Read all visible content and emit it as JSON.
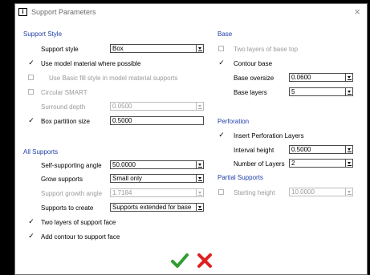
{
  "window": {
    "title": "Support Parameters",
    "close": "×"
  },
  "support_style": {
    "section": "Support Style",
    "style_label": "Support style",
    "style_value": "Box",
    "use_model_material": "Use model material where possible",
    "basic_fill": "Use Basic fill style in model material supports",
    "circular_smart": "Circular SMART",
    "surround_depth_label": "Surround depth",
    "surround_depth_value": "0.0500",
    "box_partition_label": "Box partition size",
    "box_partition_value": "0.5000"
  },
  "all_supports": {
    "section": "All Supports",
    "angle_label": "Self-supporting angle",
    "angle_value": "50.0000",
    "grow_label": "Grow supports",
    "grow_value": "Small only",
    "growth_angle_label": "Support growth angle",
    "growth_angle_value": "1.7184",
    "create_label": "Supports to create",
    "create_value": "Supports extended for base",
    "two_layers_face": "Two layers of support face",
    "add_contour": "Add contour to support face"
  },
  "base": {
    "section": "Base",
    "two_layers_top": "Two layers of base top",
    "contour_base": "Contour base",
    "oversize_label": "Base oversize",
    "oversize_value": "0.0600",
    "layers_label": "Base layers",
    "layers_value": "5"
  },
  "perforation": {
    "section": "Perforation",
    "insert": "Insert Perforation Layers",
    "interval_label": "Interval height",
    "interval_value": "0.5000",
    "num_layers_label": "Number of Layers",
    "num_layers_value": "2"
  },
  "partial": {
    "section": "Partial Supports",
    "start_label": "Starting height",
    "start_value": "10.0000"
  },
  "checkmark": "✓",
  "colors": {
    "section": "#1f3fa8",
    "ok": "#2e9e2e",
    "cancel": "#e02020"
  }
}
